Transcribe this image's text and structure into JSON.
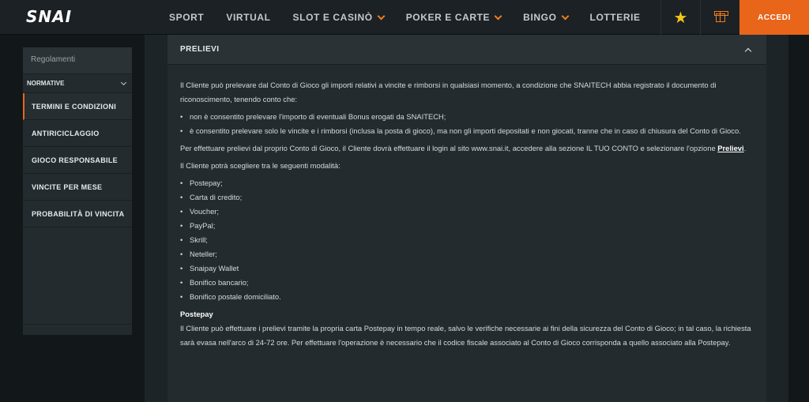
{
  "header": {
    "logo": "SNAI",
    "nav": [
      {
        "label": "SPORT",
        "has_dropdown": false
      },
      {
        "label": "VIRTUAL",
        "has_dropdown": false
      },
      {
        "label": "SLOT E CASINÒ",
        "has_dropdown": true
      },
      {
        "label": "POKER E CARTE",
        "has_dropdown": true
      },
      {
        "label": "BINGO",
        "has_dropdown": true
      },
      {
        "label": "LOTTERIE",
        "has_dropdown": false
      }
    ],
    "star_icon": "★",
    "login_label": "ACCEDI",
    "accent_color": "#e8651a"
  },
  "sidebar": {
    "title": "Regolamenti",
    "group_label": "NORMATIVE",
    "items": [
      {
        "label": "TERMINI E CONDIZIONI",
        "active": true
      },
      {
        "label": "ANTIRICICLAGGIO",
        "active": false
      },
      {
        "label": "GIOCO RESPONSABILE",
        "active": false
      },
      {
        "label": "VINCITE PER MESE",
        "active": false
      },
      {
        "label": "PROBABILITÀ DI VINCITA",
        "active": false
      }
    ]
  },
  "section": {
    "title": "PRELIEVI",
    "intro": "Il Cliente può prelevare dal Conto di Gioco gli importi relativi a vincite e rimborsi in qualsiasi momento, a condizione che SNAITECH abbia registrato il documento di riconoscimento, tenendo conto che:",
    "conditions": [
      "non è consentito prelevare l'importo di eventuali Bonus erogati da SNAITECH;",
      "è consentito prelevare solo le vincite e i rimborsi (inclusa la posta di gioco), ma non gli importi depositati e non giocati, tranne che in caso di chiusura del Conto di Gioco."
    ],
    "login_text_before": "Per effettuare prelievi dal proprio Conto di Gioco, il Cliente dovrà effettuare il login al sito www.snai.it, accedere alla sezione IL TUO CONTO e selezionare l'opzione ",
    "login_link": "Prelievi",
    "login_text_after": ".",
    "methods_intro": "Il Cliente potrà scegliere tra le seguenti modalità:",
    "methods": [
      "Postepay;",
      "Carta di credito;",
      "Voucher;",
      "PayPal;",
      "Skrill;",
      "Neteller;",
      "Snaipay Wallet",
      "Bonifico bancario;",
      "Bonifico postale domiciliato."
    ],
    "postepay_title": "Postepay",
    "postepay_text": "Il Cliente può effettuare i prelievi tramite la propria carta Postepay in tempo reale, salvo le verifiche necessarie ai fini della sicurezza del Conto di Gioco; in tal caso, la richiesta sarà evasa nell'arco di 24-72 ore. Per effettuare l'operazione è necessario che il codice fiscale associato al Conto di Gioco corrisponda a quello associato alla Postepay."
  }
}
